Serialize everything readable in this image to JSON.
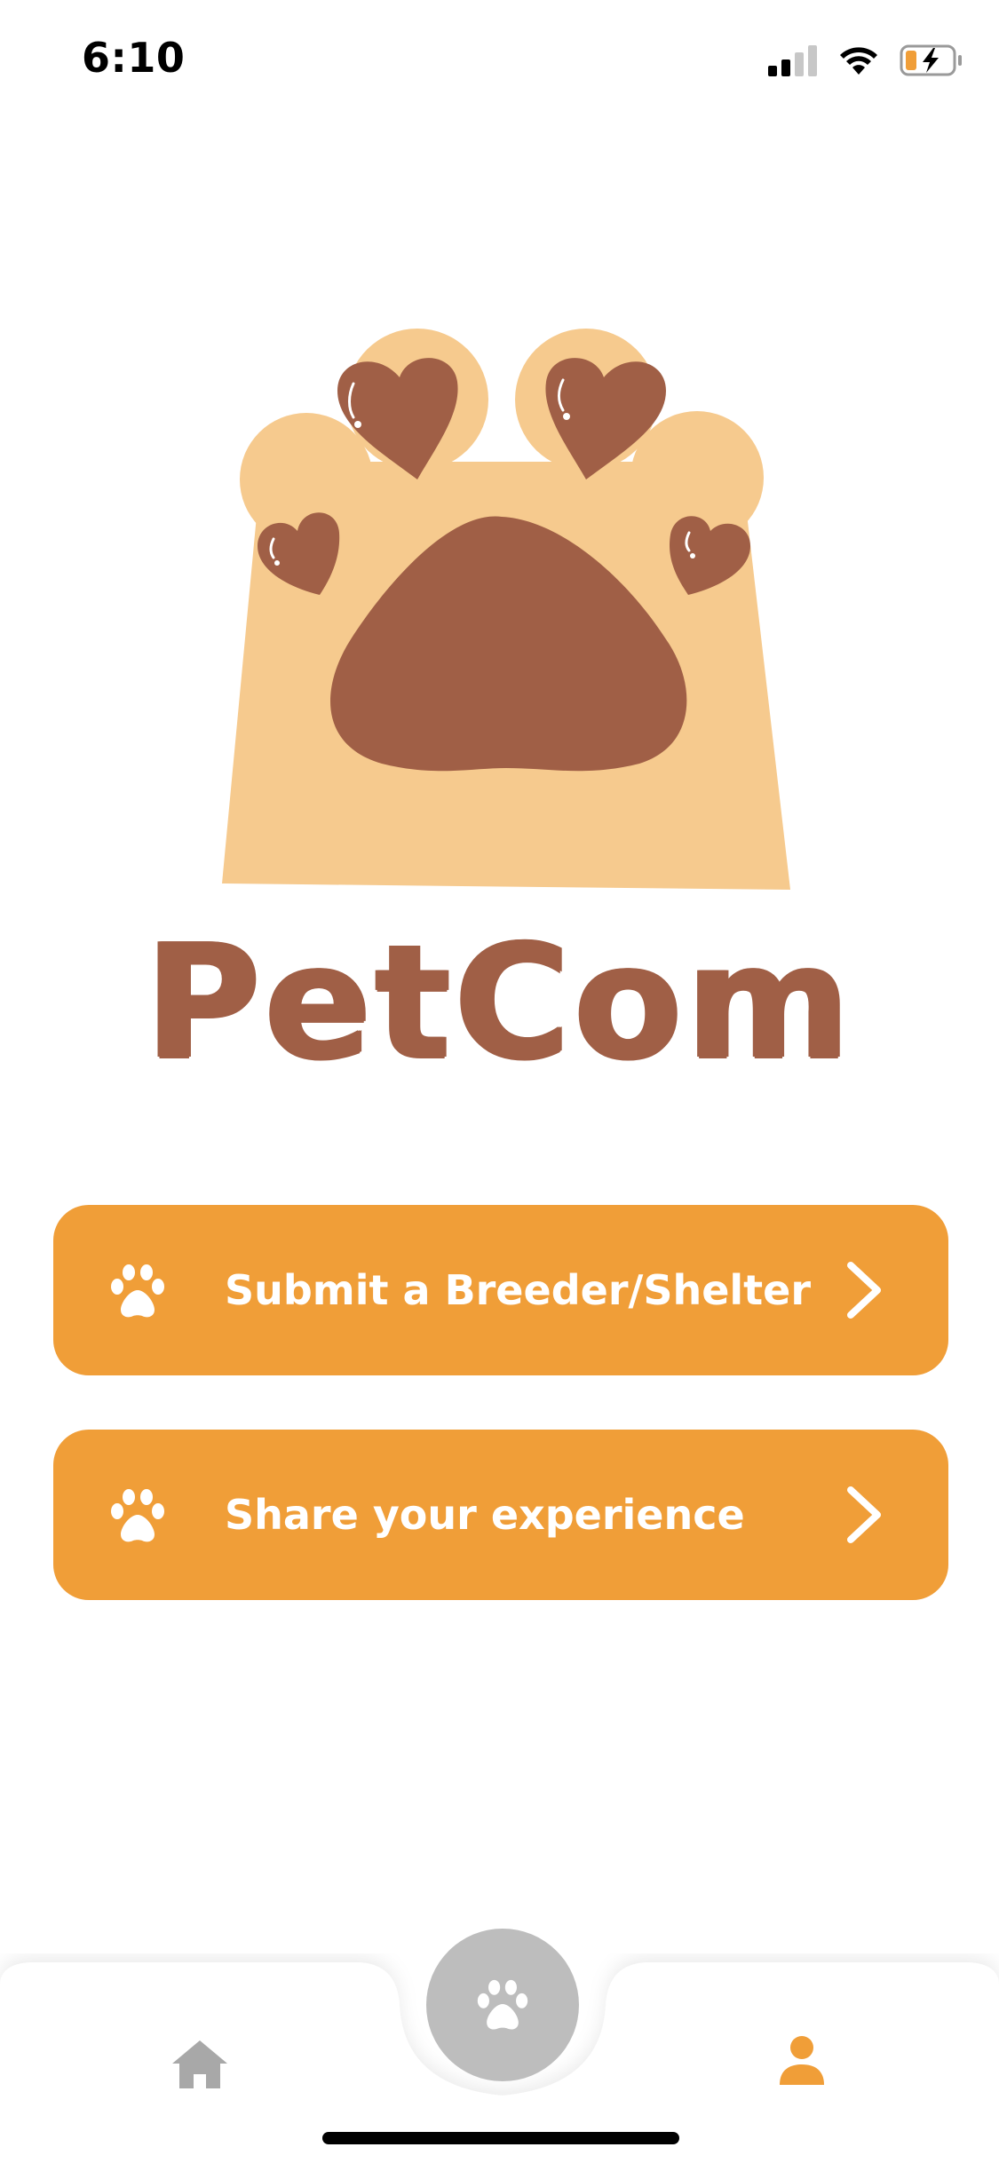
{
  "status_bar": {
    "time": "6:10"
  },
  "brand": {
    "name": "PetCom",
    "colors": {
      "paw_light": "#f6ca8e",
      "paw_dark": "#a05f46",
      "accent": "#f09e38",
      "nav_inactive": "#a8a8a8",
      "nav_center": "#bdbdbd"
    }
  },
  "actions": [
    {
      "label": "Submit a Breeder/Shelter",
      "icon": "paw-icon"
    },
    {
      "label": "Share your experience",
      "icon": "paw-icon"
    }
  ],
  "bottom_nav": {
    "items": [
      {
        "icon": "home-icon",
        "active": false
      },
      {
        "icon": "paw-icon",
        "active": false
      },
      {
        "icon": "profile-icon",
        "active": true
      }
    ]
  }
}
